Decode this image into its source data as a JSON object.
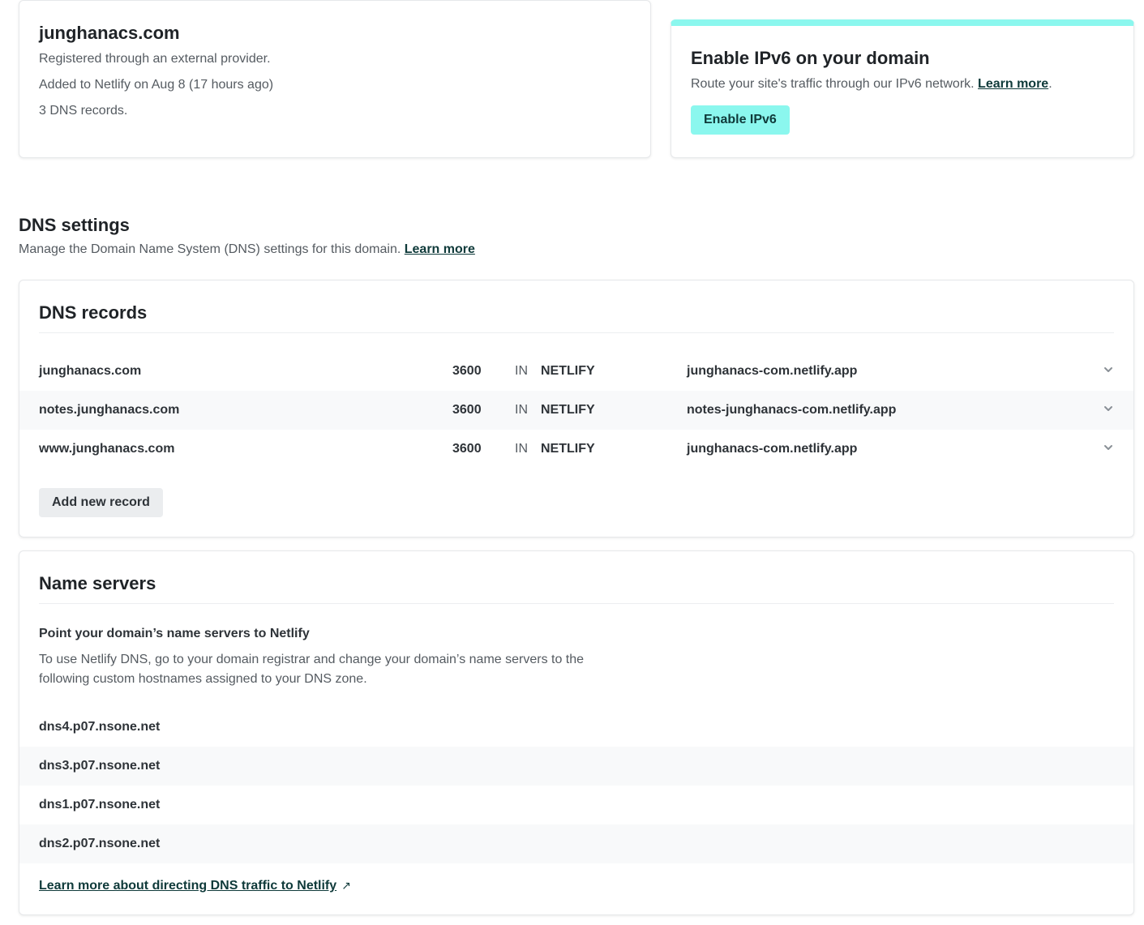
{
  "domain_card": {
    "title": "junghanacs.com",
    "registered": "Registered through an external provider.",
    "added": "Added to Netlify on Aug 8 (17 hours ago)",
    "records_count": "3 DNS records."
  },
  "ipv6_card": {
    "title": "Enable IPv6 on your domain",
    "description": "Route your site's traffic through our IPv6 network.",
    "learn_more": "Learn more",
    "button_label": "Enable IPv6",
    "accent_color": "#8bf7ee"
  },
  "dns_settings": {
    "title": "DNS settings",
    "description": "Manage the Domain Name System (DNS) settings for this domain.",
    "learn_more": "Learn more"
  },
  "dns_records": {
    "title": "DNS records",
    "rows": [
      {
        "name": "junghanacs.com",
        "ttl": "3600",
        "class": "IN",
        "type": "NETLIFY",
        "value": "junghanacs-com.netlify.app"
      },
      {
        "name": "notes.junghanacs.com",
        "ttl": "3600",
        "class": "IN",
        "type": "NETLIFY",
        "value": "notes-junghanacs-com.netlify.app"
      },
      {
        "name": "www.junghanacs.com",
        "ttl": "3600",
        "class": "IN",
        "type": "NETLIFY",
        "value": "junghanacs-com.netlify.app"
      }
    ],
    "add_button": "Add new record"
  },
  "name_servers": {
    "title": "Name servers",
    "subtitle": "Point your domain’s name servers to Netlify",
    "description": "To use Netlify DNS, go to your domain registrar and change your domain’s name servers to the following custom hostnames assigned to your DNS zone.",
    "servers": [
      "dns4.p07.nsone.net",
      "dns3.p07.nsone.net",
      "dns1.p07.nsone.net",
      "dns2.p07.nsone.net"
    ],
    "learn_more": "Learn more about directing DNS traffic to Netlify"
  }
}
